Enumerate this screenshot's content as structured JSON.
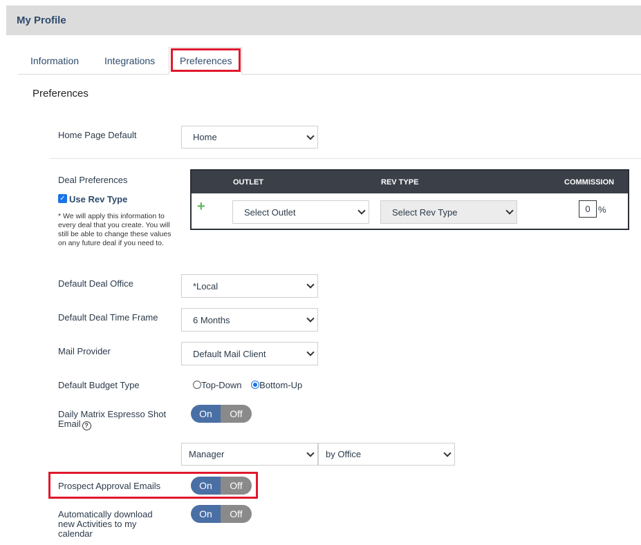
{
  "header": {
    "title": "My Profile"
  },
  "tabs": [
    {
      "label": "Information"
    },
    {
      "label": "Integrations"
    },
    {
      "label": "Preferences",
      "active": true
    }
  ],
  "section": {
    "title": "Preferences"
  },
  "home_page_default": {
    "label": "Home Page Default",
    "value": "Home"
  },
  "deal_preferences": {
    "label": "Deal Preferences",
    "use_rev_type": {
      "label": "Use Rev Type",
      "checked": true
    },
    "note": "* We will apply this information to every deal that you create. You will still be able to change these values on any future deal if you need to.",
    "table": {
      "headers": {
        "outlet": "OUTLET",
        "rev_type": "REV TYPE",
        "commission": "COMMISSION"
      },
      "row": {
        "outlet_placeholder": "Select Outlet",
        "rev_type_placeholder": "Select Rev Type",
        "commission_value": "0",
        "commission_unit": "%"
      }
    }
  },
  "default_deal_office": {
    "label": "Default Deal Office",
    "value": "*Local"
  },
  "default_deal_time_frame": {
    "label": "Default Deal Time Frame",
    "value": "6 Months"
  },
  "mail_provider": {
    "label": "Mail Provider",
    "value": "Default Mail Client"
  },
  "default_budget_type": {
    "label": "Default Budget Type",
    "options": [
      "Top-Down",
      "Bottom-Up"
    ],
    "selected": "Bottom-Up"
  },
  "daily_matrix": {
    "label_line1": "Daily Matrix Espresso Shot",
    "label_line2": "Email",
    "on": "On",
    "off": "Off",
    "role_value": "Manager",
    "group_value": "by Office"
  },
  "prospect_approval": {
    "label": "Prospect Approval Emails",
    "on": "On",
    "off": "Off"
  },
  "auto_download": {
    "label_line1": "Automatically download",
    "label_line2": "new Activities to my",
    "label_line3": "calendar",
    "on": "On",
    "off": "Off"
  },
  "colors": {
    "highlight": "#e0182d",
    "toggle_on": "#4a6fa5",
    "toggle_off": "#8a8a8a",
    "header_bg": "#dcdcdc",
    "table_head_bg": "#3b4048"
  }
}
